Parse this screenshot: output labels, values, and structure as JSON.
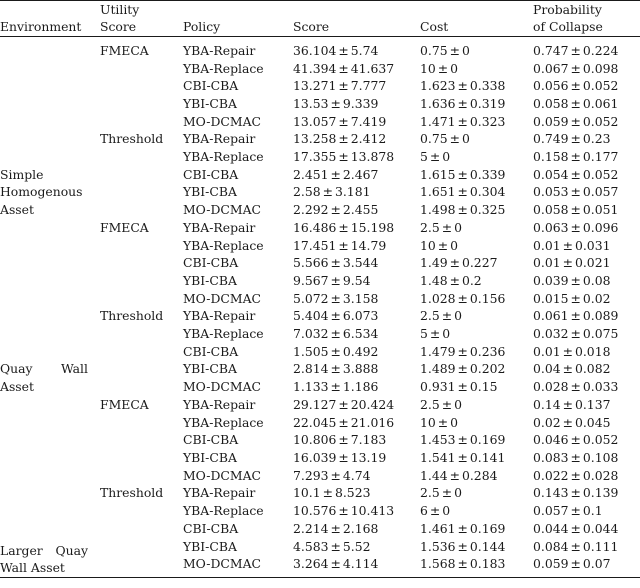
{
  "table": {
    "columns": [
      {
        "key": "environment",
        "header_lines": [
          "Environment"
        ]
      },
      {
        "key": "utility_score",
        "header_lines": [
          "Utility",
          "Score"
        ]
      },
      {
        "key": "policy",
        "header_lines": [
          "Policy"
        ]
      },
      {
        "key": "score",
        "header_lines": [
          "Score"
        ]
      },
      {
        "key": "cost",
        "header_lines": [
          "Cost"
        ]
      },
      {
        "key": "probability_of_collapse",
        "header_lines": [
          "Probability",
          "of Collapse"
        ]
      }
    ],
    "plus_minus": "±",
    "groups": [
      {
        "environment_lines": [
          "Simple",
          "Homogenous",
          "Asset"
        ],
        "environment": "Simple Homogenous Asset",
        "subgroups": [
          {
            "utility_score": "FMECA",
            "rows": [
              {
                "policy": "YBA-Repair",
                "score": "36.104 ± 5.74",
                "score_bold": false,
                "cost": "0.75 ± 0",
                "cost_bold": true,
                "prob": "0.747 ± 0.224",
                "prob_bold": false
              },
              {
                "policy": "YBA-Replace",
                "score": "41.394 ± 41.637",
                "score_bold": false,
                "cost": "10 ± 0",
                "cost_bold": false,
                "prob": "0.067 ± 0.098",
                "prob_bold": false
              },
              {
                "policy": "CBI-CBA",
                "score": "13.271 ± 7.777",
                "score_bold": false,
                "cost": "1.623 ± 0.338",
                "cost_bold": false,
                "prob": "0.056 ± 0.052",
                "prob_bold": true
              },
              {
                "policy": "YBI-CBA",
                "score": "13.53 ± 9.339",
                "score_bold": false,
                "cost": "1.636 ± 0.319",
                "cost_bold": false,
                "prob": "0.058 ± 0.061",
                "prob_bold": false
              },
              {
                "policy": "MO-DCMAC",
                "score": "13.057 ± 7.419",
                "score_bold": true,
                "cost": "1.471 ± 0.323",
                "cost_bold": false,
                "prob": "0.059 ± 0.052",
                "prob_bold": false
              }
            ]
          },
          {
            "utility_score": "Threshold",
            "rows": [
              {
                "policy": "YBA-Repair",
                "score": "13.258 ± 2.412",
                "score_bold": false,
                "cost": "0.75 ± 0",
                "cost_bold": true,
                "prob": "0.749 ± 0.23",
                "prob_bold": false
              },
              {
                "policy": "YBA-Replace",
                "score": "17.355 ± 13.878",
                "score_bold": false,
                "cost": "5 ± 0",
                "cost_bold": false,
                "prob": "0.158 ± 0.177",
                "prob_bold": false
              },
              {
                "policy": "CBI-CBA",
                "score": "2.451 ± 2.467",
                "score_bold": false,
                "cost": "1.615 ± 0.339",
                "cost_bold": false,
                "prob": "0.054 ± 0.052",
                "prob_bold": false
              },
              {
                "policy": "YBI-CBA",
                "score": "2.58 ± 3.181",
                "score_bold": false,
                "cost": "1.651 ± 0.304",
                "cost_bold": false,
                "prob": "0.053 ± 0.057",
                "prob_bold": true
              },
              {
                "policy": "MO-DCMAC",
                "score": "2.292 ± 2.455",
                "score_bold": true,
                "cost": "1.498 ± 0.325",
                "cost_bold": false,
                "prob": "0.058 ± 0.051",
                "prob_bold": false
              }
            ]
          }
        ]
      },
      {
        "environment_lines": [
          "Quay Wall",
          "Asset"
        ],
        "environment": "Quay Wall Asset",
        "subgroups": [
          {
            "utility_score": "FMECA",
            "rows": [
              {
                "policy": "YBA-Repair",
                "score": "16.486 ± 15.198",
                "score_bold": false,
                "cost": "2.5 ± 0",
                "cost_bold": false,
                "prob": "0.063 ± 0.096",
                "prob_bold": false
              },
              {
                "policy": "YBA-Replace",
                "score": "17.451 ± 14.79",
                "score_bold": false,
                "cost": "10 ± 0",
                "cost_bold": false,
                "prob": "0.01 ± 0.031",
                "prob_bold": false
              },
              {
                "policy": "CBI-CBA",
                "score": "5.566 ± 3.544",
                "score_bold": false,
                "cost": "1.49 ± 0.227",
                "cost_bold": false,
                "prob": "0.01 ± 0.021",
                "prob_bold": true
              },
              {
                "policy": "YBI-CBA",
                "score": "9.567 ± 9.54",
                "score_bold": false,
                "cost": "1.48 ± 0.2",
                "cost_bold": false,
                "prob": "0.039 ± 0.08",
                "prob_bold": false
              },
              {
                "policy": "MO-DCMAC",
                "score": "5.072 ± 3.158",
                "score_bold": true,
                "cost": "1.028 ± 0.156",
                "cost_bold": true,
                "prob": "0.015 ± 0.02",
                "prob_bold": false
              }
            ]
          },
          {
            "utility_score": "Threshold",
            "rows": [
              {
                "policy": "YBA-Repair",
                "score": "5.404 ± 6.073",
                "score_bold": false,
                "cost": "2.5 ± 0",
                "cost_bold": false,
                "prob": "0.061 ± 0.089",
                "prob_bold": false
              },
              {
                "policy": "YBA-Replace",
                "score": "7.032 ± 6.534",
                "score_bold": false,
                "cost": "5 ± 0",
                "cost_bold": false,
                "prob": "0.032 ± 0.075",
                "prob_bold": false
              },
              {
                "policy": "CBI-CBA",
                "score": "1.505 ± 0.492",
                "score_bold": false,
                "cost": "1.479 ± 0.236",
                "cost_bold": false,
                "prob": "0.01 ± 0.018",
                "prob_bold": true
              },
              {
                "policy": "YBI-CBA",
                "score": "2.814 ± 3.888",
                "score_bold": false,
                "cost": "1.489 ± 0.202",
                "cost_bold": false,
                "prob": "0.04 ± 0.082",
                "prob_bold": false
              },
              {
                "policy": "MO-DCMAC",
                "score": "1.133 ± 1.186",
                "score_bold": true,
                "cost": "0.931 ± 0.15",
                "cost_bold": true,
                "prob": "0.028 ± 0.033",
                "prob_bold": false
              }
            ]
          }
        ]
      },
      {
        "environment_lines": [
          "Larger Quay",
          "Wall Asset"
        ],
        "environment": "Larger Quay Wall Asset",
        "subgroups": [
          {
            "utility_score": "FMECA",
            "rows": [
              {
                "policy": "YBA-Repair",
                "score": "29.127 ± 20.424",
                "score_bold": false,
                "cost": "2.5 ± 0",
                "cost_bold": false,
                "prob": "0.14 ± 0.137",
                "prob_bold": false
              },
              {
                "policy": "YBA-Replace",
                "score": "22.045 ± 21.016",
                "score_bold": false,
                "cost": "10 ± 0",
                "cost_bold": false,
                "prob": "0.02 ± 0.045",
                "prob_bold": true
              },
              {
                "policy": "CBI-CBA",
                "score": "10.806 ± 7.183",
                "score_bold": false,
                "cost": "1.453 ± 0.169",
                "cost_bold": false,
                "prob": "0.046 ± 0.052",
                "prob_bold": false
              },
              {
                "policy": "YBI-CBA",
                "score": "16.039 ± 13.19",
                "score_bold": false,
                "cost": "1.541 ± 0.141",
                "cost_bold": false,
                "prob": "0.083 ± 0.108",
                "prob_bold": false
              },
              {
                "policy": "MO-DCMAC",
                "score": "7.293 ± 4.74",
                "score_bold": true,
                "cost": "1.44 ± 0.284",
                "cost_bold": true,
                "prob": "0.022 ± 0.028",
                "prob_bold": false
              }
            ]
          },
          {
            "utility_score": "Threshold",
            "rows": [
              {
                "policy": "YBA-Repair",
                "score": "10.1 ± 8.523",
                "score_bold": false,
                "cost": "2.5 ± 0",
                "cost_bold": false,
                "prob": "0.143 ± 0.139",
                "prob_bold": false
              },
              {
                "policy": "YBA-Replace",
                "score": "10.576 ± 10.413",
                "score_bold": false,
                "cost": "6 ± 0",
                "cost_bold": false,
                "prob": "0.057 ± 0.1",
                "prob_bold": false
              },
              {
                "policy": "CBI-CBA",
                "score": "2.214 ± 2.168",
                "score_bold": true,
                "cost": "1.461 ± 0.169",
                "cost_bold": true,
                "prob": "0.044 ± 0.044",
                "prob_bold": true
              },
              {
                "policy": "YBI-CBA",
                "score": "4.583 ± 5.52",
                "score_bold": false,
                "cost": "1.536 ± 0.144",
                "cost_bold": false,
                "prob": "0.084 ± 0.111",
                "prob_bold": false
              },
              {
                "policy": "MO-DCMAC",
                "score": "3.264 ± 4.114",
                "score_bold": false,
                "cost": "1.568 ± 0.183",
                "cost_bold": false,
                "prob": "0.059 ± 0.07",
                "prob_bold": false
              }
            ]
          }
        ]
      }
    ]
  }
}
